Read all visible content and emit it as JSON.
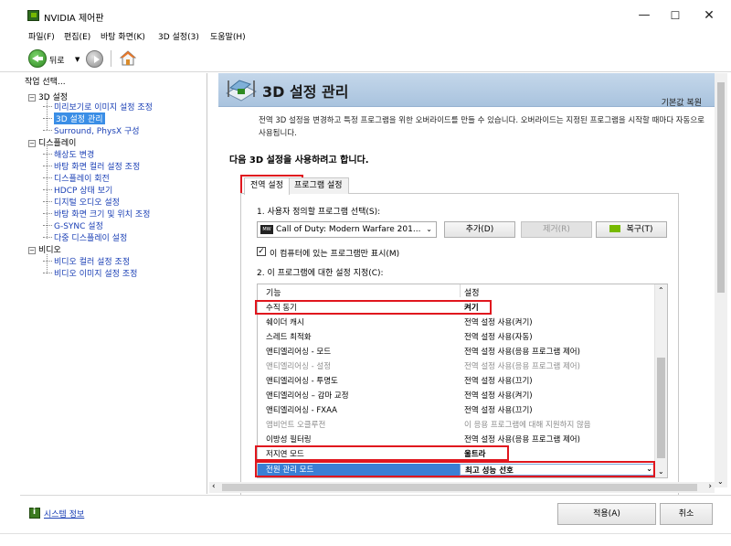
{
  "window": {
    "title": "NVIDIA 제어판"
  },
  "menu": [
    "파일(F)",
    "편집(E)",
    "바탕 화면(K)",
    "3D 설정(3)",
    "도움말(H)"
  ],
  "toolbar": {
    "back_label": "뒤로"
  },
  "left_panel": {
    "header": "작업 선택...",
    "categories": [
      {
        "label": "3D 설정",
        "items": [
          "미리보기로 이미지 설정 조정",
          "3D 설정 관리",
          "Surround, PhysX 구성"
        ]
      },
      {
        "label": "디스플레이",
        "items": [
          "해상도 변경",
          "바탕 화면 컬러 설정 조정",
          "디스플레이 회전",
          "HDCP 상태 보기",
          "디지털 오디오 설정",
          "바탕 화면 크기 및 위치 조정",
          "G-SYNC 설정",
          "다중 디스플레이 설정"
        ]
      },
      {
        "label": "비디오",
        "items": [
          "비디오 컬러 설정 조정",
          "비디오 이미지 설정 조정"
        ]
      }
    ]
  },
  "main": {
    "title": "3D 설정 관리",
    "restore_defaults": "기본값 복원",
    "description": "전역 3D 설정을 변경하고 특정 프로그램을 위한 오버라이드를 만들 수 있습니다. 오버라이드는 지정된 프로그램을 시작할 때마다 자동으로 사용됩니다.",
    "sub_heading": "다음 3D 설정을 사용하려고 합니다.",
    "tabs": [
      "전역 설정",
      "프로그램 설정"
    ],
    "step1_label": "1. 사용자 정의할 프로그램 선택(S):",
    "program_combo_value": "Call of Duty: Modern Warfare 201...",
    "add_button": "추가(D)",
    "remove_button": "제거(R)",
    "restore_button": "복구(T)",
    "checkbox_label": "이 컴퓨터에 있는 프로그램만 표시(M)",
    "step2_label": "2. 이 프로그램에 대한 설정 지정(C):",
    "table": {
      "col_feature": "기능",
      "col_setting": "설정",
      "rows": [
        {
          "feature": "수직 동기",
          "setting": "켜기"
        },
        {
          "feature": "쉐이더 캐시",
          "setting": "전역 설정 사용(켜기)"
        },
        {
          "feature": "스레드 최적화",
          "setting": "전역 설정 사용(자동)"
        },
        {
          "feature": "앤티엘리어싱 - 모드",
          "setting": "전역 설정 사용(응용 프로그램 제어)"
        },
        {
          "feature": "앤티엘리어싱 - 설정",
          "setting": "전역 설정 사용(응용 프로그램 제어)"
        },
        {
          "feature": "앤티엘리어싱 - 투명도",
          "setting": "전역 설정 사용(끄기)"
        },
        {
          "feature": "앤티엘리어싱 – 감마 교정",
          "setting": "전역 설정 사용(켜기)"
        },
        {
          "feature": "앤티엘리어싱 - FXAA",
          "setting": "전역 설정 사용(끄기)"
        },
        {
          "feature": "앰비언트 오클루전",
          "setting": "이 응용 프로그램에 대해 지원하지 않음"
        },
        {
          "feature": "이방성 필터링",
          "setting": "전역 설정 사용(응용 프로그램 제어)"
        },
        {
          "feature": "저지연 모드",
          "setting": "울트라"
        },
        {
          "feature": "전원 관리 모드",
          "setting": "최고 성능 선호"
        }
      ]
    }
  },
  "bottom": {
    "system_info": "시스템 정보",
    "apply": "적용(A)",
    "cancel": "취소"
  },
  "colors": {
    "highlight_red": "#e0161e",
    "selection_blue": "#3a7fd4",
    "nvidia_green": "#76b900"
  }
}
